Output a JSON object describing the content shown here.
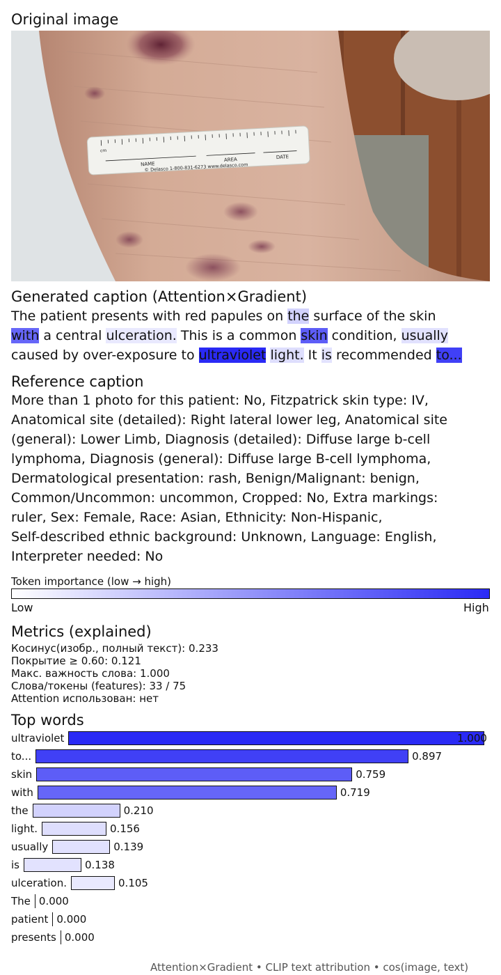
{
  "sections": {
    "original_title": "Original image",
    "generated_title": "Generated caption (Attention×Gradient)",
    "reference_title": "Reference caption",
    "metrics_title": "Metrics (explained)",
    "topwords_title": "Top words"
  },
  "photo": {
    "ruler_unit": "cm",
    "ruler_name": "NAME",
    "ruler_area": "AREA",
    "ruler_date": "DATE",
    "ruler_footer": "© Delasco 1-800-831-6273   www.delasco.com",
    "colors": {
      "skin": "#c9a08a",
      "background_wall": "#dde2e4",
      "floor": "#8c4f2f",
      "lesion": "#6e2a3c"
    }
  },
  "caption_tokens": [
    [
      {
        "text": "The",
        "w": 0.0
      },
      {
        "text": " patient",
        "w": 0.0
      },
      {
        "text": " presents",
        "w": 0.0
      },
      {
        "text": " with",
        "w": 0.0
      },
      {
        "text": " red",
        "w": 0.0
      },
      {
        "text": " papules",
        "w": 0.0
      },
      {
        "text": " on ",
        "w": 0.0
      },
      {
        "text": "the",
        "w": 0.21
      },
      {
        "text": " surface",
        "w": 0.0
      },
      {
        "text": " of",
        "w": 0.0
      },
      {
        "text": " the",
        "w": 0.0
      },
      {
        "text": " skin",
        "w": 0.0
      }
    ],
    [
      {
        "text": "with",
        "w": 0.719
      },
      {
        "text": " a central ",
        "w": 0.0
      },
      {
        "text": "ulceration.",
        "w": 0.105
      },
      {
        "text": " This is a common ",
        "w": 0.0
      },
      {
        "text": "skin",
        "w": 0.759
      },
      {
        "text": " condition, ",
        "w": 0.0
      },
      {
        "text": "usually",
        "w": 0.139
      }
    ],
    [
      {
        "text": "caused by over-exposure to ",
        "w": 0.0
      },
      {
        "text": "ultraviolet",
        "w": 1.0
      },
      {
        "text": " ",
        "w": 0.0
      },
      {
        "text": "light.",
        "w": 0.156
      },
      {
        "text": " It ",
        "w": 0.0
      },
      {
        "text": "is",
        "w": 0.138
      },
      {
        "text": " recommended ",
        "w": 0.0
      },
      {
        "text": "to...",
        "w": 0.897
      }
    ]
  ],
  "reference_lines": [
    "More than 1 photo for this patient: No, Fitzpatrick skin type: IV,",
    "Anatomical site (detailed): Right lateral lower leg, Anatomical site",
    "(general): Lower Limb, Diagnosis (detailed): Diffuse large b-cell",
    "lymphoma, Diagnosis (general): Diffuse large B-cell lymphoma,",
    "Dermatological presentation: rash, Benign/Malignant: benign,",
    "Common/Uncommon: uncommon, Cropped: No, Extra markings:",
    "ruler, Sex: Female, Race: Asian, Ethnicity: Non-Hispanic,",
    "Self-described ethnic background: Unknown, Language: English,",
    "Interpreter needed: No"
  ],
  "colorbar": {
    "title": "Token importance (low → high)",
    "low": "Low",
    "high": "High",
    "color_low": "#ffffff",
    "color_high": "#2a2af5"
  },
  "metrics": [
    "Косинус(изобр., полный текст): 0.233",
    "Покрытие ≥ 0.60: 0.121",
    "Макс. важность слова: 1.000",
    "Слова/токены (features): 33 / 75",
    "Attention использован: нет"
  ],
  "top_words": [
    {
      "word": "ultraviolet",
      "value": 1.0,
      "label": "1.000"
    },
    {
      "word": "to...",
      "value": 0.897,
      "label": "0.897"
    },
    {
      "word": "skin",
      "value": 0.759,
      "label": "0.759"
    },
    {
      "word": "with",
      "value": 0.719,
      "label": "0.719"
    },
    {
      "word": "the",
      "value": 0.21,
      "label": "0.210"
    },
    {
      "word": "light.",
      "value": 0.156,
      "label": "0.156"
    },
    {
      "word": "usually",
      "value": 0.139,
      "label": "0.139"
    },
    {
      "word": "is",
      "value": 0.138,
      "label": "0.138"
    },
    {
      "word": "ulceration.",
      "value": 0.105,
      "label": "0.105"
    },
    {
      "word": "The",
      "value": 0.0,
      "label": "0.000"
    },
    {
      "word": "patient",
      "value": 0.0,
      "label": "0.000"
    },
    {
      "word": "presents",
      "value": 0.0,
      "label": "0.000"
    }
  ],
  "footer": "Attention×Gradient • CLIP text attribution • cos(image, text)"
}
